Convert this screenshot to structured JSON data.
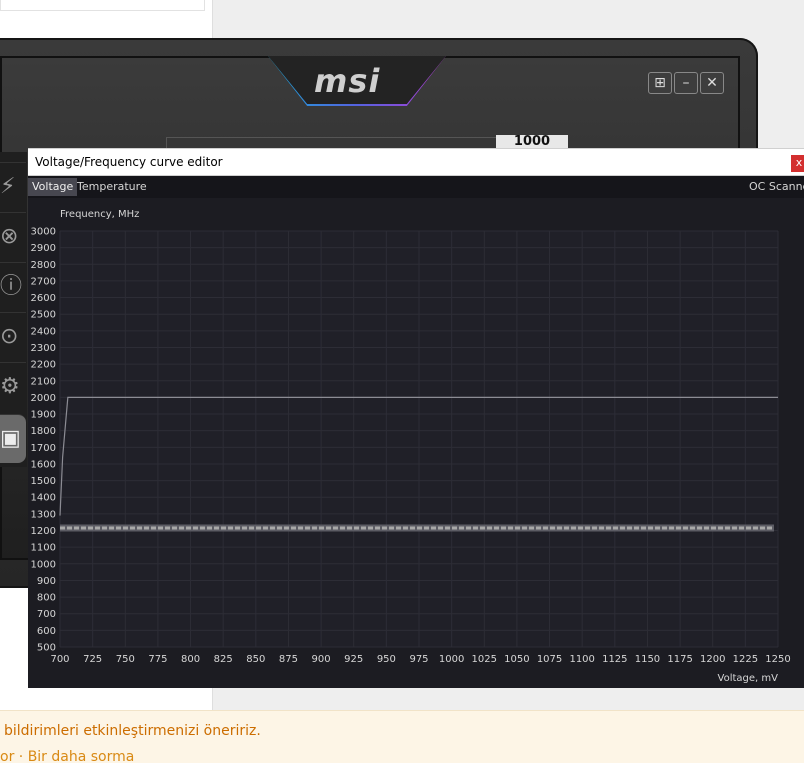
{
  "background": {
    "notification_message": "bildirimleri etkinleştirmenizi öneririz.",
    "notification_links": [
      "or",
      "Bir daha sorma"
    ],
    "notification_separator": " · "
  },
  "afterburner": {
    "logo_text": "msi",
    "window_buttons": [
      "windows-icon",
      "minimize-icon",
      "close-icon"
    ],
    "value_display": "1000",
    "side_icons": [
      "k-boost-icon",
      "back-icon",
      "info-icon",
      "oc-scanner-icon",
      "settings-icon",
      "monitor-icon"
    ]
  },
  "curve_editor": {
    "title": "Voltage/Frequency curve editor",
    "close_label": "x",
    "tabs": [
      {
        "label": "Voltage",
        "active": true
      },
      {
        "label": "Temperature",
        "active": false
      },
      {
        "label": "OC Scanne",
        "active": false
      }
    ]
  },
  "chart_data": {
    "type": "line",
    "ylabel": "Frequency, MHz",
    "xlabel": "Voltage, mV",
    "xlim": [
      700,
      1250
    ],
    "ylim": [
      500,
      3000
    ],
    "x_ticks": [
      700,
      725,
      750,
      775,
      800,
      825,
      850,
      875,
      900,
      925,
      950,
      975,
      1000,
      1025,
      1050,
      1075,
      1100,
      1125,
      1150,
      1175,
      1200,
      1225,
      1250
    ],
    "y_ticks": [
      500,
      600,
      700,
      800,
      900,
      1000,
      1100,
      1200,
      1300,
      1400,
      1500,
      1600,
      1700,
      1800,
      1900,
      2000,
      2100,
      2200,
      2300,
      2400,
      2500,
      2600,
      2700,
      2800,
      2900,
      3000
    ],
    "grid": true,
    "series": [
      {
        "x": [
          700,
          702,
          706,
          1250
        ],
        "y": [
          1290,
          1640,
          2000,
          2000
        ],
        "color": "#8c8c94"
      }
    ],
    "reference_line": {
      "y": 1215,
      "color": "#a8a8a8",
      "style": "dashed"
    }
  },
  "colors": {
    "chart_bg": "#1c1c22",
    "plot_bg": "#202028",
    "grid": "#2d2d36",
    "tick_text": "#d6d6d6"
  }
}
